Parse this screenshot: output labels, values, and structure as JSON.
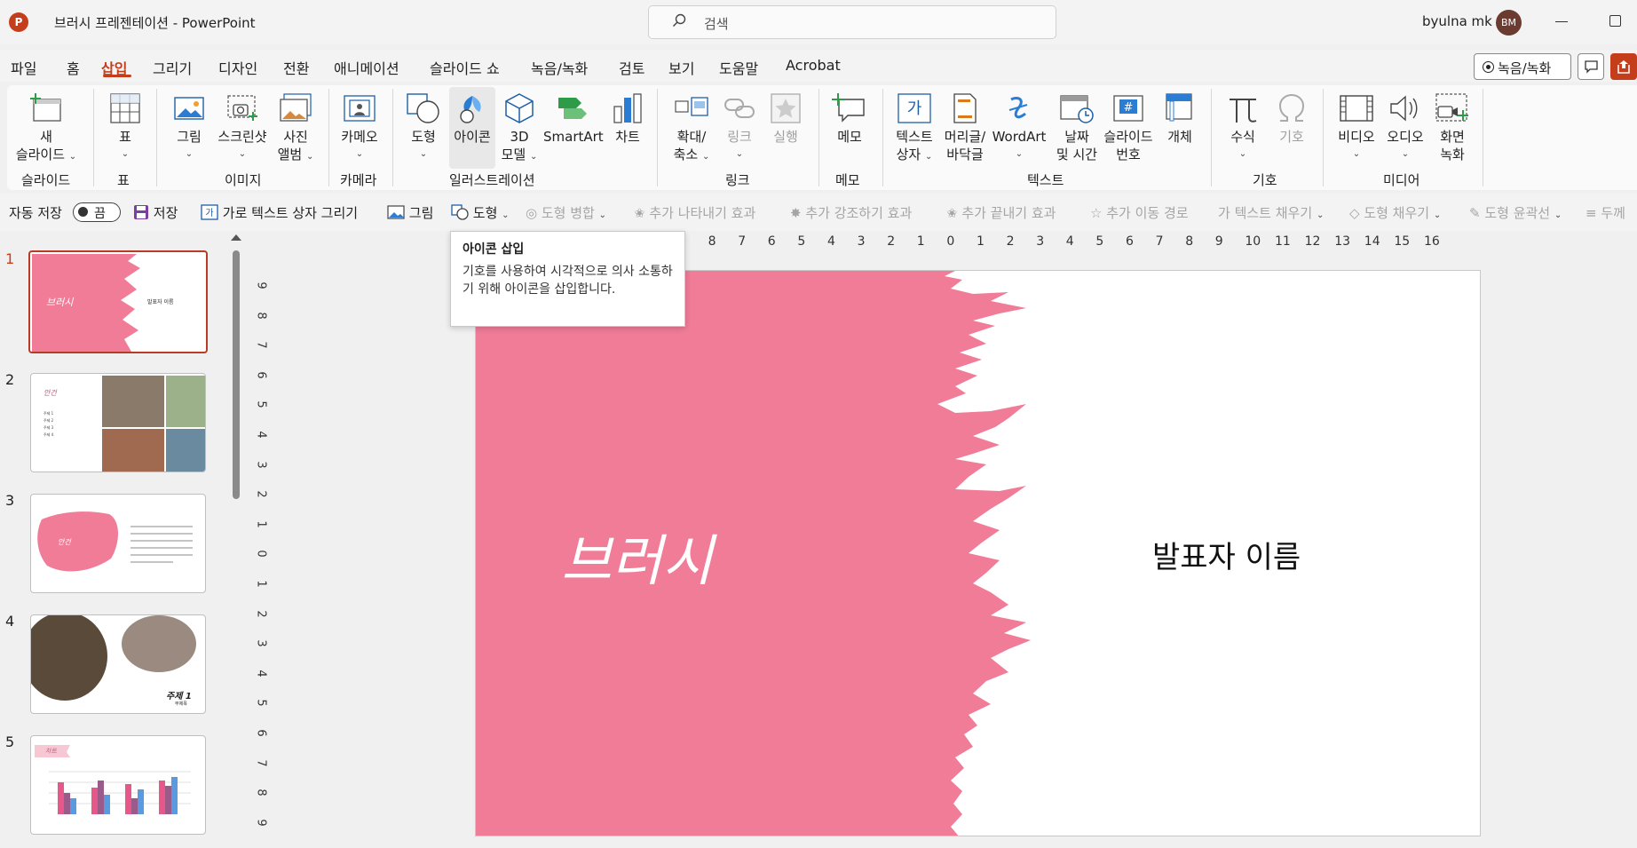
{
  "titlebar": {
    "doc_title": "브러시 프레젠테이션  -  PowerPoint",
    "logo": "P",
    "search_placeholder": "검색",
    "user_name": "byulna mk",
    "user_initials": "BM"
  },
  "menu": [
    {
      "label": "파일",
      "active": false
    },
    {
      "label": "홈",
      "active": false
    },
    {
      "label": "삽입",
      "active": true
    },
    {
      "label": "그리기",
      "active": false
    },
    {
      "label": "디자인",
      "active": false
    },
    {
      "label": "전환",
      "active": false
    },
    {
      "label": "애니메이션",
      "active": false
    },
    {
      "label": "슬라이드 쇼",
      "active": false
    },
    {
      "label": "녹음/녹화",
      "active": false
    },
    {
      "label": "검토",
      "active": false
    },
    {
      "label": "보기",
      "active": false
    },
    {
      "label": "도움말",
      "active": false
    },
    {
      "label": "Acrobat",
      "active": false
    }
  ],
  "record_button": "녹음/녹화",
  "ribbon": {
    "new_slide": [
      "새",
      "슬라이드"
    ],
    "table": "표",
    "picture": "그림",
    "screenshot": "스크린샷",
    "photo_album": [
      "사진",
      "앨범"
    ],
    "cameo": "카메오",
    "shapes": "도형",
    "icons": "아이콘",
    "model3d": [
      "3D",
      "모델"
    ],
    "smartart": "SmartArt",
    "chart": "차트",
    "zoom": [
      "확대/",
      "축소"
    ],
    "link": "링크",
    "action": "실행",
    "comment": "메모",
    "textbox": [
      "텍스트",
      "상자"
    ],
    "header_footer": [
      "머리글/",
      "바닥글"
    ],
    "wordart": "WordArt",
    "datetime": [
      "날짜",
      "및 시간"
    ],
    "slide_number": [
      "슬라이드",
      "번호"
    ],
    "object": "개체",
    "equation": "수식",
    "symbol": "기호",
    "video": "비디오",
    "audio": "오디오",
    "screen_recording": [
      "화면",
      "녹화"
    ],
    "groups": {
      "slides": "슬라이드",
      "tables": "표",
      "images": "이미지",
      "camera": "카메라",
      "illustrations": "일러스트레이션",
      "links": "링크",
      "comments": "메모",
      "text": "텍스트",
      "symbols": "기호",
      "media": "미디어"
    }
  },
  "quick_toolbar": {
    "autosave": "자동 저장",
    "autosave_state": "끔",
    "save": "저장",
    "draw_textbox": "가로 텍스트 상자 그리기",
    "picture": "그림",
    "shapes": "도형",
    "merge_shapes": "도형 병합",
    "add_entrance": "추가 나타내기 효과",
    "add_emphasis": "추가 강조하기 효과",
    "add_exit": "추가 끝내기 효과",
    "add_motion": "추가 이동 경로",
    "text_fill": "텍스트 채우기",
    "shape_fill": "도형 채우기",
    "shape_outline": "도형 윤곽선",
    "weight": "두께"
  },
  "tooltip": {
    "title": "아이콘 삽입",
    "description": "기호를 사용하여 시각적으로 의사 소통하기 위해 아이콘을 삽입합니다."
  },
  "slides": [
    {
      "number": "1",
      "title": "브러시",
      "subtitle": "발표자 이름"
    },
    {
      "number": "2",
      "title": "안건",
      "items": [
        "주제 1",
        "주제 2",
        "주제 3",
        "주제 4"
      ]
    },
    {
      "number": "3",
      "title": "안건"
    },
    {
      "number": "4",
      "title": "주제 1",
      "subtitle": "부제목"
    },
    {
      "number": "5",
      "title": "차트"
    }
  ],
  "ruler_h": [
    "9",
    "8",
    "7",
    "6",
    "5",
    "4",
    "3",
    "2",
    "1",
    "0",
    "1",
    "2",
    "3",
    "4",
    "5",
    "6",
    "7",
    "8",
    "9",
    "10",
    "11",
    "12",
    "13",
    "14",
    "15",
    "16"
  ],
  "ruler_v": [
    "9",
    "8",
    "7",
    "6",
    "5",
    "4",
    "3",
    "2",
    "1",
    "0",
    "1",
    "2",
    "3",
    "4",
    "5",
    "6",
    "7",
    "8",
    "9"
  ],
  "main_slide": {
    "title": "브러시",
    "subtitle": "발표자 이름",
    "brush_color": "#f07c98"
  },
  "colors": {
    "accent": "#c43e1c",
    "brush": "#f07c98"
  }
}
